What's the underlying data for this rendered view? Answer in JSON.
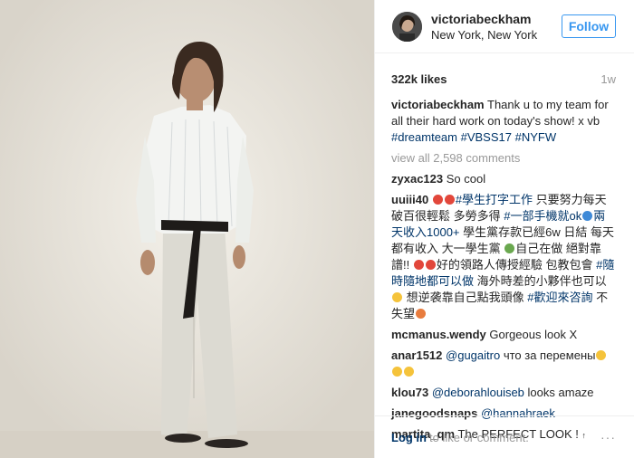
{
  "post": {
    "image_alt": "Photo of a woman on a runway",
    "header": {
      "username": "victoriabeckham",
      "location": "New York, New York",
      "follow_label": "Follow"
    },
    "likes": "322k likes",
    "time": "1w",
    "caption": {
      "user": "victoriabeckham",
      "text": "Thank u to my team for all their hard work on today's show! x vb",
      "tags": [
        "#dreamteam",
        "#VBSS17",
        "#NYFW"
      ]
    },
    "view_all": "view all 2,598 comments",
    "comments": [
      {
        "user": "zyxac123",
        "text": "So cool"
      },
      {
        "user": "uuiii40",
        "parts": {
          "a_tag": "#學生打字工作",
          "b_text": "只要努力每天破百很輕鬆 多勞多得",
          "c_tag": "#一部手機就ok",
          "d_tag": "兩天收入1000+",
          "e_text": "學生黨存款已經6w 日結 每天都有收入 大一學生黨",
          "f_text": "自己在做 絕對靠譜!!",
          "g_text": "好的領路人傳授經驗 包教包會",
          "h_tag": "#隨時隨地都可以做",
          "i_text": "海外時差的小夥伴也可以",
          "j_text": "想逆袭靠自己點我頭像",
          "k_tag": "#歡迎來咨詢",
          "l_text": "不失望"
        }
      },
      {
        "user": "mcmanus.wendy",
        "text": "Gorgeous look X"
      },
      {
        "user": "anar1512",
        "mention": "@gugaitro",
        "text": "что за перемены"
      },
      {
        "user": "klou73",
        "mention": "@deborahlouiseb",
        "text": "looks amaze"
      },
      {
        "user": "janegoodsnaps",
        "mention": "@hannahraek",
        "text": ""
      },
      {
        "user": "martita_qm",
        "text": "The PERFECT LOOK !"
      }
    ],
    "footer": {
      "login": "Log in",
      "rest": "to like or comment.",
      "more": "···"
    }
  }
}
